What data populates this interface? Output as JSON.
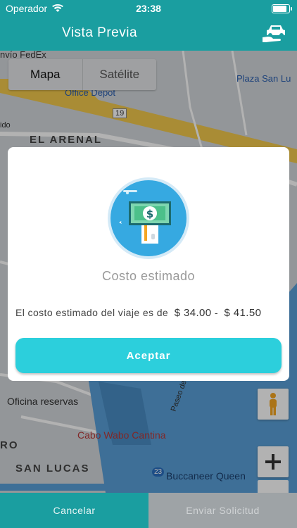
{
  "status_bar": {
    "carrier": "Operador",
    "time": "23:38",
    "battery_level": 0.95
  },
  "navbar": {
    "title": "Vista Previa",
    "right_icon": "car-hand-icon"
  },
  "map": {
    "type_control": {
      "options": [
        "Mapa",
        "Satélite"
      ],
      "selected": "Mapa"
    },
    "labels": {
      "fedex": "nvío FedEx",
      "plaza": "Plaza San Lu",
      "office_depot": "Office Depot",
      "highway": "19",
      "el_arenal": "EL ARENAL",
      "oficina": "Oficina reservas",
      "cabo_wabo": "Cabo Wabo Cantina",
      "ro": "RO",
      "san_lucas": "SAN LUCAS",
      "buccaneer": "Buccaneer Queen",
      "paseo": "Paseo de L",
      "ido": "ido",
      "ferry_number": "23"
    },
    "colors": {
      "water": "#5aa0d8",
      "road": "#f2c94c",
      "land": "#cfd4d8"
    }
  },
  "modal": {
    "icon": "money-bill-sign-icon",
    "title": "Costo estimado",
    "description_prefix": "El costo estimado del viaje es de",
    "price_min": "$ 34.00",
    "separator": "-",
    "price_max": "$ 41.50",
    "accept_label": "Aceptar",
    "accent_color": "#2ccfdc"
  },
  "bottom_bar": {
    "cancel_label": "Cancelar",
    "send_label": "Enviar Solicitud"
  }
}
